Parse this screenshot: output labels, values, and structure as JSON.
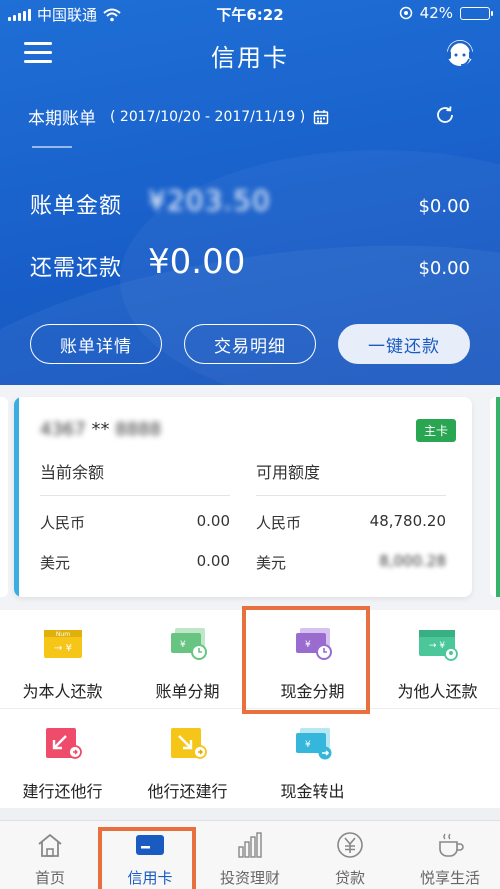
{
  "status_bar": {
    "carrier": "中国联通",
    "time": "下午6:22",
    "battery": "42%",
    "battery_level": 0.42
  },
  "header": {
    "title": "信用卡"
  },
  "bill": {
    "period_label": "本期账单",
    "period_range": "( 2017/10/20 - 2017/11/19 )",
    "amount_label": "账单金额",
    "amount_value": "¥203.50",
    "amount_usd": "$0.00",
    "due_label": "还需还款",
    "due_value": "¥0.00",
    "due_usd": "$0.00"
  },
  "actions": {
    "detail": "账单详情",
    "transactions": "交易明细",
    "repay": "一键还款"
  },
  "card": {
    "number_masked_prefix": "4367",
    "number_mid": "**",
    "number_suffix": "8888",
    "badge": "主卡",
    "balance_header": "当前余额",
    "credit_header": "可用额度",
    "rmb_label": "人民币",
    "usd_label": "美元",
    "balance_rmb": "0.00",
    "balance_usd": "0.00",
    "credit_rmb": "48,780.20",
    "credit_usd": "8,000.28"
  },
  "functions": [
    {
      "label": "为本人还款"
    },
    {
      "label": "账单分期"
    },
    {
      "label": "现金分期"
    },
    {
      "label": "为他人还款"
    },
    {
      "label": "建行还他行"
    },
    {
      "label": "他行还建行"
    },
    {
      "label": "现金转出"
    }
  ],
  "icon_labels": {
    "num": "Num",
    "yen": "¥",
    "arrows": "→ ¥"
  },
  "tabs": [
    {
      "label": "首页"
    },
    {
      "label": "信用卡"
    },
    {
      "label": "投资理财"
    },
    {
      "label": "贷款"
    },
    {
      "label": "悦享生活"
    }
  ],
  "colors": {
    "brand_blue": "#1a62cc",
    "highlight": "#e8703e",
    "badge_green": "#2aa551"
  }
}
